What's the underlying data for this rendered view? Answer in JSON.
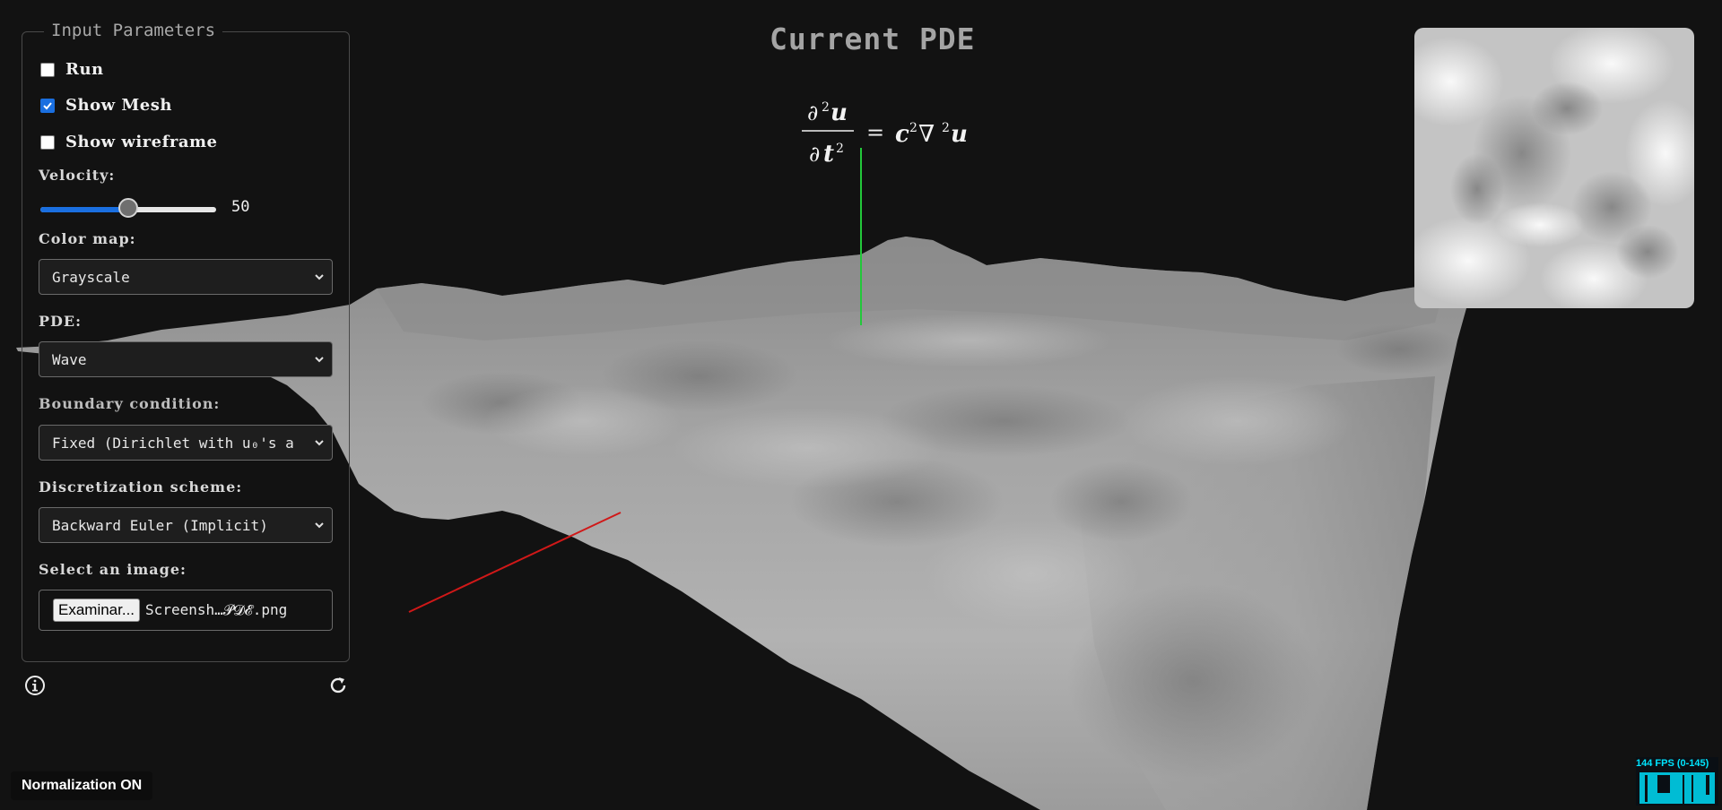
{
  "panel": {
    "legend": "Input Parameters",
    "run": {
      "label": "Run",
      "checked": false
    },
    "show_mesh": {
      "label": "Show Mesh",
      "checked": true
    },
    "show_wireframe": {
      "label": "Show wireframe",
      "checked": false
    },
    "velocity": {
      "label": "Velocity:",
      "value": "50",
      "fraction": 0.5
    },
    "color_map": {
      "label": "Color map:",
      "selected": "Grayscale"
    },
    "pde": {
      "label": "PDE:",
      "selected": "Wave"
    },
    "boundary": {
      "label": "Boundary condition:",
      "selected": "Fixed (Dirichlet with u₀'s a"
    },
    "scheme": {
      "label": "Discretization scheme:",
      "selected": "Backward Euler (Implicit)"
    },
    "image": {
      "label": "Select an image:",
      "button": "Examinar...",
      "file": "Screensh…𝓟𝓓𝓔.png"
    }
  },
  "main": {
    "title": "Current PDE"
  },
  "status": {
    "normalization": "Normalization ON",
    "fps": "144 FPS (0-145)"
  },
  "icons": {
    "info": "info-icon",
    "reset": "reset-icon"
  },
  "colors": {
    "accent": "#1a6fe0",
    "axis_y": "#22c83a",
    "axis_x": "#d01818",
    "fps": "#00e5ff"
  }
}
